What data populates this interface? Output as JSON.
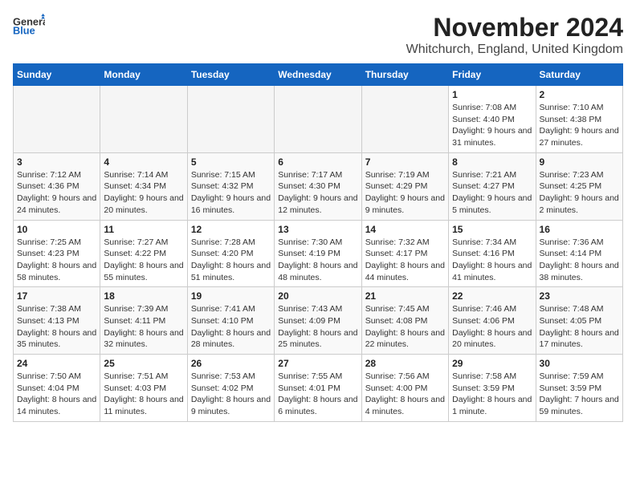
{
  "logo": {
    "general": "General",
    "blue": "Blue"
  },
  "header": {
    "month": "November 2024",
    "location": "Whitchurch, England, United Kingdom"
  },
  "weekdays": [
    "Sunday",
    "Monday",
    "Tuesday",
    "Wednesday",
    "Thursday",
    "Friday",
    "Saturday"
  ],
  "weeks": [
    [
      {
        "day": "",
        "info": ""
      },
      {
        "day": "",
        "info": ""
      },
      {
        "day": "",
        "info": ""
      },
      {
        "day": "",
        "info": ""
      },
      {
        "day": "",
        "info": ""
      },
      {
        "day": "1",
        "info": "Sunrise: 7:08 AM\nSunset: 4:40 PM\nDaylight: 9 hours and 31 minutes."
      },
      {
        "day": "2",
        "info": "Sunrise: 7:10 AM\nSunset: 4:38 PM\nDaylight: 9 hours and 27 minutes."
      }
    ],
    [
      {
        "day": "3",
        "info": "Sunrise: 7:12 AM\nSunset: 4:36 PM\nDaylight: 9 hours and 24 minutes."
      },
      {
        "day": "4",
        "info": "Sunrise: 7:14 AM\nSunset: 4:34 PM\nDaylight: 9 hours and 20 minutes."
      },
      {
        "day": "5",
        "info": "Sunrise: 7:15 AM\nSunset: 4:32 PM\nDaylight: 9 hours and 16 minutes."
      },
      {
        "day": "6",
        "info": "Sunrise: 7:17 AM\nSunset: 4:30 PM\nDaylight: 9 hours and 12 minutes."
      },
      {
        "day": "7",
        "info": "Sunrise: 7:19 AM\nSunset: 4:29 PM\nDaylight: 9 hours and 9 minutes."
      },
      {
        "day": "8",
        "info": "Sunrise: 7:21 AM\nSunset: 4:27 PM\nDaylight: 9 hours and 5 minutes."
      },
      {
        "day": "9",
        "info": "Sunrise: 7:23 AM\nSunset: 4:25 PM\nDaylight: 9 hours and 2 minutes."
      }
    ],
    [
      {
        "day": "10",
        "info": "Sunrise: 7:25 AM\nSunset: 4:23 PM\nDaylight: 8 hours and 58 minutes."
      },
      {
        "day": "11",
        "info": "Sunrise: 7:27 AM\nSunset: 4:22 PM\nDaylight: 8 hours and 55 minutes."
      },
      {
        "day": "12",
        "info": "Sunrise: 7:28 AM\nSunset: 4:20 PM\nDaylight: 8 hours and 51 minutes."
      },
      {
        "day": "13",
        "info": "Sunrise: 7:30 AM\nSunset: 4:19 PM\nDaylight: 8 hours and 48 minutes."
      },
      {
        "day": "14",
        "info": "Sunrise: 7:32 AM\nSunset: 4:17 PM\nDaylight: 8 hours and 44 minutes."
      },
      {
        "day": "15",
        "info": "Sunrise: 7:34 AM\nSunset: 4:16 PM\nDaylight: 8 hours and 41 minutes."
      },
      {
        "day": "16",
        "info": "Sunrise: 7:36 AM\nSunset: 4:14 PM\nDaylight: 8 hours and 38 minutes."
      }
    ],
    [
      {
        "day": "17",
        "info": "Sunrise: 7:38 AM\nSunset: 4:13 PM\nDaylight: 8 hours and 35 minutes."
      },
      {
        "day": "18",
        "info": "Sunrise: 7:39 AM\nSunset: 4:11 PM\nDaylight: 8 hours and 32 minutes."
      },
      {
        "day": "19",
        "info": "Sunrise: 7:41 AM\nSunset: 4:10 PM\nDaylight: 8 hours and 28 minutes."
      },
      {
        "day": "20",
        "info": "Sunrise: 7:43 AM\nSunset: 4:09 PM\nDaylight: 8 hours and 25 minutes."
      },
      {
        "day": "21",
        "info": "Sunrise: 7:45 AM\nSunset: 4:08 PM\nDaylight: 8 hours and 22 minutes."
      },
      {
        "day": "22",
        "info": "Sunrise: 7:46 AM\nSunset: 4:06 PM\nDaylight: 8 hours and 20 minutes."
      },
      {
        "day": "23",
        "info": "Sunrise: 7:48 AM\nSunset: 4:05 PM\nDaylight: 8 hours and 17 minutes."
      }
    ],
    [
      {
        "day": "24",
        "info": "Sunrise: 7:50 AM\nSunset: 4:04 PM\nDaylight: 8 hours and 14 minutes."
      },
      {
        "day": "25",
        "info": "Sunrise: 7:51 AM\nSunset: 4:03 PM\nDaylight: 8 hours and 11 minutes."
      },
      {
        "day": "26",
        "info": "Sunrise: 7:53 AM\nSunset: 4:02 PM\nDaylight: 8 hours and 9 minutes."
      },
      {
        "day": "27",
        "info": "Sunrise: 7:55 AM\nSunset: 4:01 PM\nDaylight: 8 hours and 6 minutes."
      },
      {
        "day": "28",
        "info": "Sunrise: 7:56 AM\nSunset: 4:00 PM\nDaylight: 8 hours and 4 minutes."
      },
      {
        "day": "29",
        "info": "Sunrise: 7:58 AM\nSunset: 3:59 PM\nDaylight: 8 hours and 1 minute."
      },
      {
        "day": "30",
        "info": "Sunrise: 7:59 AM\nSunset: 3:59 PM\nDaylight: 7 hours and 59 minutes."
      }
    ]
  ]
}
